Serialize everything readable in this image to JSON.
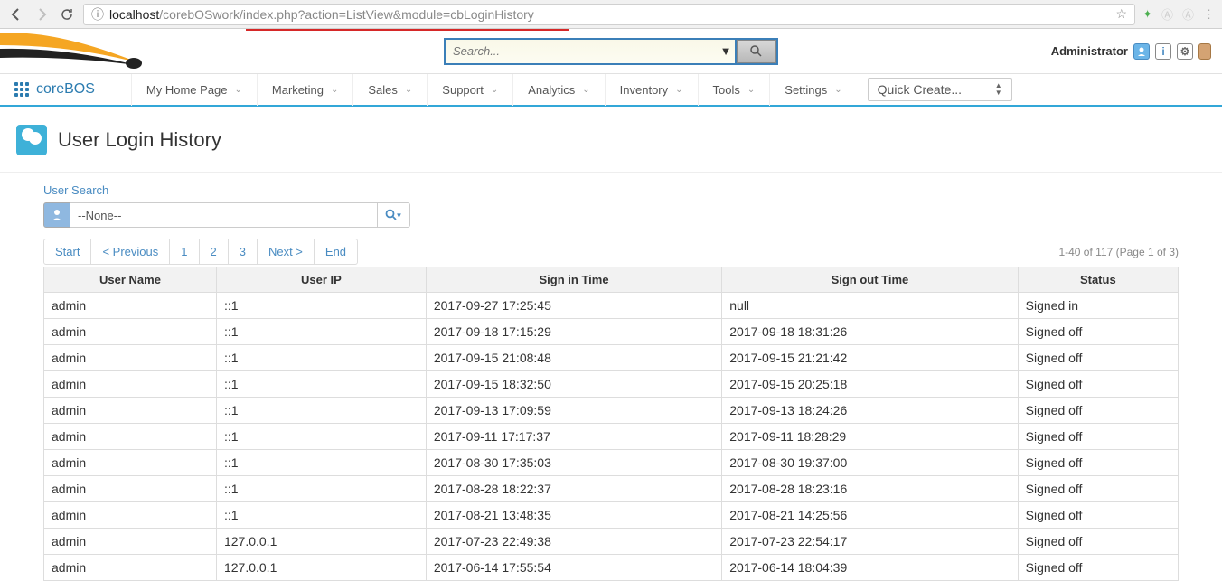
{
  "browser": {
    "url_host": "localhost",
    "url_path": "/corebOSwork/index.php?action=ListView&module=cbLoginHistory"
  },
  "header": {
    "search_placeholder": "Search...",
    "admin_label": "Administrator"
  },
  "nav": {
    "brand": "coreBOS",
    "items": [
      "My Home Page",
      "Marketing",
      "Sales",
      "Support",
      "Analytics",
      "Inventory",
      "Tools",
      "Settings"
    ],
    "quick_create": "Quick Create..."
  },
  "page": {
    "title": "User Login History",
    "user_search_label": "User Search",
    "user_search_value": "--None--"
  },
  "pagination": {
    "start": "Start",
    "prev": "< Previous",
    "pages": [
      "1",
      "2",
      "3"
    ],
    "next": "Next >",
    "end": "End",
    "info": "1-40 of 117 (Page 1 of 3)"
  },
  "table": {
    "headers": [
      "User Name",
      "User IP",
      "Sign in Time",
      "Sign out Time",
      "Status"
    ],
    "rows": [
      [
        "admin",
        "::1",
        "2017-09-27 17:25:45",
        "null",
        "Signed in"
      ],
      [
        "admin",
        "::1",
        "2017-09-18 17:15:29",
        "2017-09-18 18:31:26",
        "Signed off"
      ],
      [
        "admin",
        "::1",
        "2017-09-15 21:08:48",
        "2017-09-15 21:21:42",
        "Signed off"
      ],
      [
        "admin",
        "::1",
        "2017-09-15 18:32:50",
        "2017-09-15 20:25:18",
        "Signed off"
      ],
      [
        "admin",
        "::1",
        "2017-09-13 17:09:59",
        "2017-09-13 18:24:26",
        "Signed off"
      ],
      [
        "admin",
        "::1",
        "2017-09-11 17:17:37",
        "2017-09-11 18:28:29",
        "Signed off"
      ],
      [
        "admin",
        "::1",
        "2017-08-30 17:35:03",
        "2017-08-30 19:37:00",
        "Signed off"
      ],
      [
        "admin",
        "::1",
        "2017-08-28 18:22:37",
        "2017-08-28 18:23:16",
        "Signed off"
      ],
      [
        "admin",
        "::1",
        "2017-08-21 13:48:35",
        "2017-08-21 14:25:56",
        "Signed off"
      ],
      [
        "admin",
        "127.0.0.1",
        "2017-07-23 22:49:38",
        "2017-07-23 22:54:17",
        "Signed off"
      ],
      [
        "admin",
        "127.0.0.1",
        "2017-06-14 17:55:54",
        "2017-06-14 18:04:39",
        "Signed off"
      ]
    ]
  }
}
